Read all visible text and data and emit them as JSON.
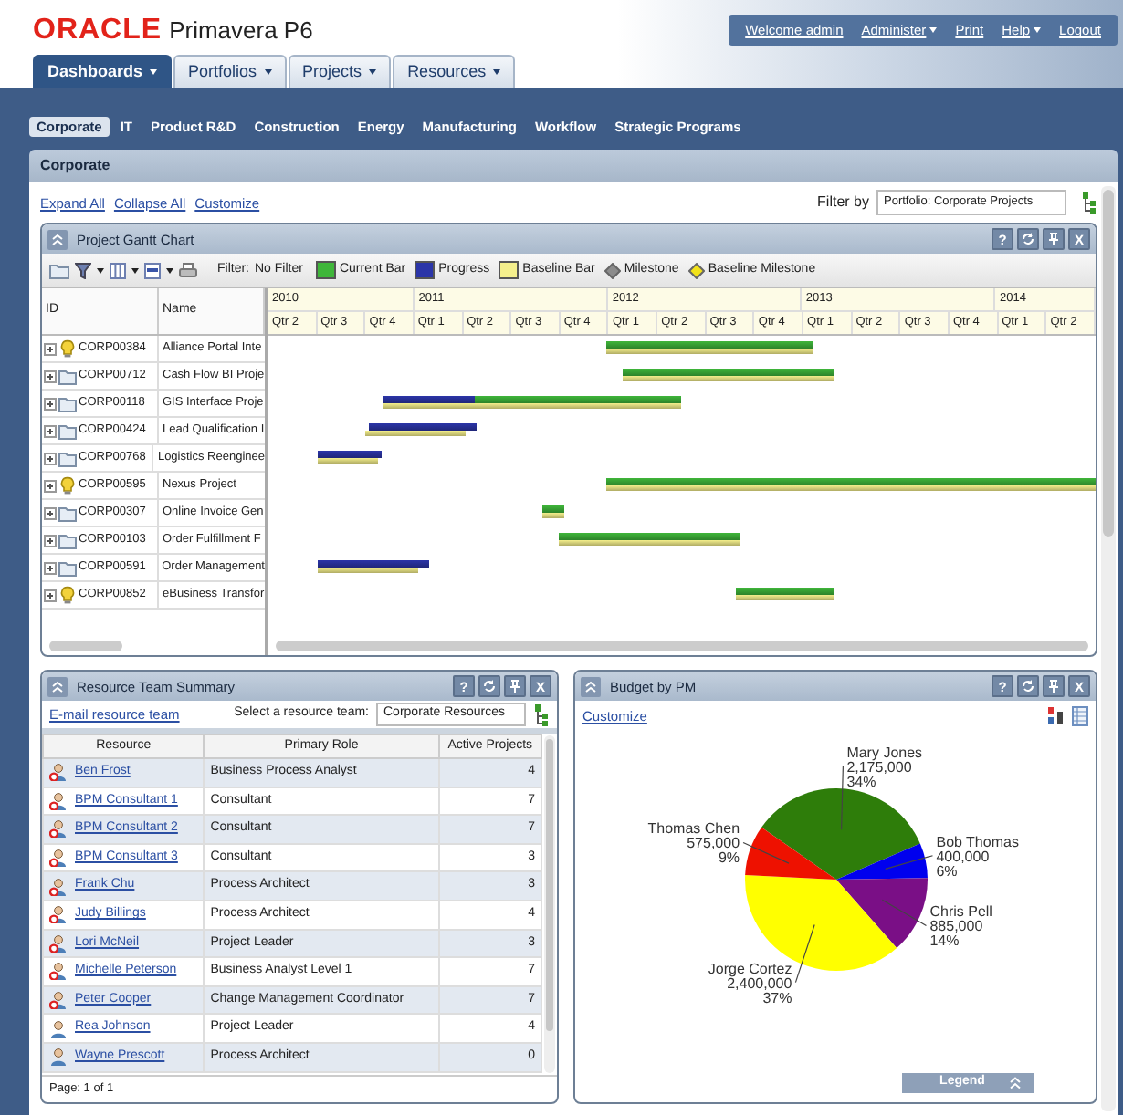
{
  "header": {
    "logo_brand": "ORACLE",
    "logo_product": "Primavera P6",
    "user_menu": [
      {
        "label": "Welcome admin",
        "dropdown": false
      },
      {
        "label": "Administer",
        "dropdown": true
      },
      {
        "label": "Print",
        "dropdown": false
      },
      {
        "label": "Help",
        "dropdown": true
      },
      {
        "label": "Logout",
        "dropdown": false
      }
    ]
  },
  "main_tabs": [
    {
      "label": "Dashboards",
      "selected": true
    },
    {
      "label": "Portfolios",
      "selected": false
    },
    {
      "label": "Projects",
      "selected": false
    },
    {
      "label": "Resources",
      "selected": false
    }
  ],
  "dashboard_tabs": [
    {
      "label": "Corporate",
      "selected": true
    },
    {
      "label": "IT",
      "selected": false
    },
    {
      "label": "Product R&D",
      "selected": false
    },
    {
      "label": "Construction",
      "selected": false
    },
    {
      "label": "Energy",
      "selected": false
    },
    {
      "label": "Manufacturing",
      "selected": false
    },
    {
      "label": "Workflow",
      "selected": false
    },
    {
      "label": "Strategic Programs",
      "selected": false
    }
  ],
  "page_title": "Corporate",
  "links": [
    "Expand All",
    "Collapse All",
    "Customize"
  ],
  "filter": {
    "label": "Filter by",
    "value": "Portfolio: Corporate Projects"
  },
  "gantt": {
    "title": "Project Gantt Chart",
    "help": "?",
    "close": "X",
    "filter_label": "Filter:",
    "filter_value": "No Filter",
    "legend": [
      {
        "label": "Current Bar",
        "kind": "current",
        "color": "#3fb63a"
      },
      {
        "label": "Progress",
        "kind": "progress",
        "color": "#2b35a8"
      },
      {
        "label": "Baseline Bar",
        "kind": "baseline",
        "color": "#f4ef8c"
      },
      {
        "label": "Milestone",
        "kind": "milestone",
        "color": "#8c8c8c"
      },
      {
        "label": "Baseline Milestone",
        "kind": "baseline_milestone",
        "color": "#f2e21a"
      }
    ],
    "columns": [
      "ID",
      "Name"
    ],
    "years": [
      {
        "label": "2010",
        "quarters": [
          "Qtr 2",
          "Qtr 3",
          "Qtr 4"
        ]
      },
      {
        "label": "2011",
        "quarters": [
          "Qtr 1",
          "Qtr 2",
          "Qtr 3",
          "Qtr 4"
        ]
      },
      {
        "label": "2012",
        "quarters": [
          "Qtr 1",
          "Qtr 2",
          "Qtr 3",
          "Qtr 4"
        ]
      },
      {
        "label": "2013",
        "quarters": [
          "Qtr 1",
          "Qtr 2",
          "Qtr 3",
          "Qtr 4"
        ]
      },
      {
        "label": "2014",
        "quarters": [
          "Qtr 1",
          "Qtr 2"
        ]
      }
    ],
    "rows": [
      {
        "id": "CORP00384",
        "name": "Alliance Portal Inte",
        "kind": "bulb",
        "bars": [
          {
            "kind": "current"
          },
          {
            "kind": "baseline"
          }
        ]
      },
      {
        "id": "CORP00712",
        "name": "Cash Flow BI Proje",
        "kind": "folder",
        "bars": [
          {
            "kind": "current"
          },
          {
            "kind": "baseline"
          }
        ]
      },
      {
        "id": "CORP00118",
        "name": "GIS Interface Proje",
        "kind": "folder",
        "bars": [
          {
            "kind": "progress"
          },
          {
            "kind": "current"
          },
          {
            "kind": "baseline"
          }
        ]
      },
      {
        "id": "CORP00424",
        "name": "Lead Qualification I",
        "kind": "folder",
        "bars": [
          {
            "kind": "progress"
          },
          {
            "kind": "baseline"
          }
        ]
      },
      {
        "id": "CORP00768",
        "name": "Logistics Reenginee",
        "kind": "folder",
        "bars": [
          {
            "kind": "progress"
          },
          {
            "kind": "baseline"
          }
        ]
      },
      {
        "id": "CORP00595",
        "name": "Nexus Project",
        "kind": "bulb",
        "bars": [
          {
            "kind": "current"
          },
          {
            "kind": "baseline"
          }
        ]
      },
      {
        "id": "CORP00307",
        "name": "Online Invoice Gen",
        "kind": "folder",
        "bars": [
          {
            "kind": "current"
          },
          {
            "kind": "baseline"
          }
        ]
      },
      {
        "id": "CORP00103",
        "name": "Order Fulfillment F",
        "kind": "folder",
        "bars": [
          {
            "kind": "current"
          },
          {
            "kind": "baseline"
          }
        ]
      },
      {
        "id": "CORP00591",
        "name": "Order Management",
        "kind": "folder",
        "bars": [
          {
            "kind": "progress"
          },
          {
            "kind": "baseline"
          }
        ]
      },
      {
        "id": "CORP00852",
        "name": "eBusiness Transfor",
        "kind": "bulb",
        "bars": [
          {
            "kind": "current"
          },
          {
            "kind": "baseline"
          }
        ]
      }
    ]
  },
  "resources": {
    "title": "Resource Team Summary",
    "help": "?",
    "close": "X",
    "email_link": "E-mail resource team",
    "team_label": "Select a resource team:",
    "team_value": "Corporate Resources",
    "columns": [
      "Resource",
      "Primary Role",
      "Active Projects"
    ],
    "rows": [
      {
        "name": "Ben Frost",
        "role": "Business Process Analyst",
        "projects": "4",
        "kind": "flagged"
      },
      {
        "name": "BPM Consultant 1",
        "role": "Consultant",
        "projects": "7",
        "kind": "flagged"
      },
      {
        "name": "BPM Consultant 2",
        "role": "Consultant",
        "projects": "7",
        "kind": "flagged"
      },
      {
        "name": "BPM Consultant 3",
        "role": "Consultant",
        "projects": "3",
        "kind": "flagged"
      },
      {
        "name": "Frank Chu",
        "role": "Process Architect",
        "projects": "3",
        "kind": "flagged"
      },
      {
        "name": "Judy Billings",
        "role": "Process Architect",
        "projects": "4",
        "kind": "flagged"
      },
      {
        "name": "Lori McNeil",
        "role": "Project Leader",
        "projects": "3",
        "kind": "flagged"
      },
      {
        "name": "Michelle Peterson",
        "role": "Business Analyst Level 1",
        "projects": "7",
        "kind": "flagged"
      },
      {
        "name": "Peter Cooper",
        "role": "Change Management Coordinator",
        "projects": "7",
        "kind": "flagged"
      },
      {
        "name": "Rea Johnson",
        "role": "Project Leader",
        "projects": "4",
        "kind": "plain"
      },
      {
        "name": "Wayne Prescott",
        "role": "Process Architect",
        "projects": "0",
        "kind": "plain"
      }
    ],
    "pager": "Page: 1 of 1"
  },
  "budget": {
    "title": "Budget by PM",
    "help": "?",
    "close": "X",
    "customize_link": "Customize",
    "legend_button": "Legend",
    "chart_data": {
      "type": "pie",
      "categories": [
        "Mary Jones",
        "Bob Thomas",
        "Chris Pell",
        "Jorge Cortez",
        "Thomas Chen"
      ],
      "values": [
        2175000,
        400000,
        885000,
        2400000,
        575000
      ],
      "colors": [
        "#2e7d0a",
        "#0000ee",
        "#7a0f86",
        "#ffff00",
        "#ee1100"
      ],
      "data_labels": true,
      "value_labels": [
        "2,175,000\n34%",
        "400,000\n6%",
        "885,000\n14%",
        "2,400,000\n37%",
        "575,000\n9%"
      ]
    }
  }
}
